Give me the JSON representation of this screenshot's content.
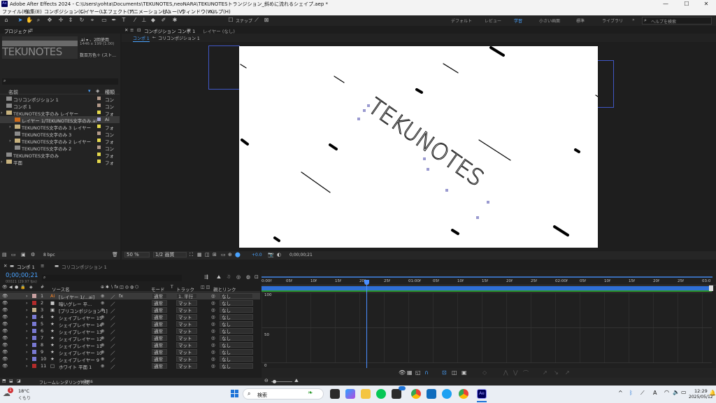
{
  "titlebar": {
    "title": "Adobe After Effects 2024 - C:\\Users\\yohta\\Documents\\TEKUNOTES,neoNARA\\TEKUNOTESトランジション_斜めに流れるシェイプ.aep *",
    "logo": "Ae",
    "min": "—",
    "max": "☐",
    "close": "✕"
  },
  "menu": [
    "ファイル(F)",
    "編集(E)",
    "コンポジション(C)",
    "レイヤー(L)",
    "エフェクト(T)",
    "アニメーション(A)",
    "ビュー(V)",
    "ウィンドウ(W)",
    "ヘルプ(H)"
  ],
  "toolbar": {
    "snap": "スナップ",
    "workspaces": [
      "デフォルト",
      "レビュー",
      "学習",
      "小さい画面",
      "標準",
      "ライブラリ"
    ],
    "search_placeholder": "ヘルプを検索"
  },
  "project": {
    "tab": "プロジェクト",
    "thumb_text": "TEKUNOTES",
    "info1": ".ai ▾ 、2回使用",
    "info2": "1446 x 199 (1.00)",
    "info3": "数百万色＋ (スト...",
    "columns": {
      "name": "名前",
      "type": "種類"
    },
    "items": [
      {
        "name": "コリコンポジション 1",
        "type": "コン",
        "kind": "comp",
        "indent": 0
      },
      {
        "name": "コンポ 1",
        "type": "コン",
        "kind": "comp",
        "indent": 0
      },
      {
        "name": "TEKUNOTES文字のみ レイヤー",
        "type": "フォ",
        "kind": "folder",
        "indent": 0
      },
      {
        "name": "レイヤー 1/TEKUNOTES文字のみ.ai",
        "type": "Ai",
        "kind": "ai",
        "indent": 1
      },
      {
        "name": "TEKUNOTES文字のみ 3 レイヤー",
        "type": "フォ",
        "kind": "folder",
        "indent": 1
      },
      {
        "name": "TEKUNOTES文字のみ 3",
        "type": "コン",
        "kind": "comp",
        "indent": 1
      },
      {
        "name": "TEKUNOTES文字のみ 2 レイヤー",
        "type": "フォ",
        "kind": "folder",
        "indent": 1
      },
      {
        "name": "TEKUNOTES文字のみ 2",
        "type": "コン",
        "kind": "comp",
        "indent": 1
      },
      {
        "name": "TEKUNOTES文字のみ",
        "type": "フォ",
        "kind": "comp",
        "indent": 0
      },
      {
        "name": "平面",
        "type": "フォ",
        "kind": "folder",
        "indent": 0
      }
    ],
    "bpc": "8 bpc"
  },
  "comp": {
    "tab": "コンポジション コンポ 1",
    "layer_tab": "レイヤー (なし)",
    "breadcrumbs": [
      "コンポ 1",
      "コリコンポジション 1"
    ],
    "canvas_text": "TEKUNOTES",
    "zoom": "50 %",
    "resolution": "1/2 画質",
    "exposure": "+0.0",
    "timecode": "0;00;00;21"
  },
  "timeline": {
    "tabs": [
      "コンポ 1",
      "コリコンポジション 1"
    ],
    "current_time": "0;00;00;21",
    "frame_info": "00021 (29.97 fps)",
    "headers": {
      "source": "ソース名",
      "mode": "モード",
      "track": "トラックマット",
      "parent": "親とリンク"
    },
    "ruler": [
      "0:00f",
      "05f",
      "10f",
      "15f",
      "20f",
      "25f",
      "01:00f",
      "05f",
      "10f",
      "15f",
      "20f",
      "25f",
      "02:00f",
      "05f",
      "10f",
      "15f",
      "20f",
      "25f",
      "03:0"
    ],
    "graph_labels": [
      "100",
      "50",
      "0"
    ],
    "layers": [
      {
        "num": "1",
        "name": "[レイヤー 1/...ai]",
        "color": "#c8a0a0",
        "mode": "通常",
        "track": "1. 平行",
        "parent": "なし",
        "icon": "Ai"
      },
      {
        "num": "2",
        "name": "暗いグレー 平...",
        "color": "#b22b2b",
        "mode": "通常",
        "track": "マット",
        "parent": "なし",
        "icon": "■"
      },
      {
        "num": "3",
        "name": "[プリコンポジション 1]",
        "color": "#c2b08a",
        "mode": "通常",
        "track": "マット",
        "parent": "なし",
        "icon": "▣"
      },
      {
        "num": "4",
        "name": "シェイプレイヤー 15",
        "color": "#7979d2",
        "mode": "通常",
        "track": "マット",
        "parent": "なし",
        "icon": "★"
      },
      {
        "num": "5",
        "name": "シェイプレイヤー 14",
        "color": "#7979d2",
        "mode": "通常",
        "track": "マット",
        "parent": "なし",
        "icon": "★"
      },
      {
        "num": "6",
        "name": "シェイプレイヤー 13",
        "color": "#7979d2",
        "mode": "通常",
        "track": "マット",
        "parent": "なし",
        "icon": "★"
      },
      {
        "num": "7",
        "name": "シェイプレイヤー 12",
        "color": "#7979d2",
        "mode": "通常",
        "track": "マット",
        "parent": "なし",
        "icon": "★"
      },
      {
        "num": "8",
        "name": "シェイプレイヤー 11",
        "color": "#7979d2",
        "mode": "通常",
        "track": "マット",
        "parent": "なし",
        "icon": "★"
      },
      {
        "num": "9",
        "name": "シェイプレイヤー 10",
        "color": "#7979d2",
        "mode": "通常",
        "track": "マット",
        "parent": "なし",
        "icon": "★"
      },
      {
        "num": "10",
        "name": "シェイプレイヤー 9",
        "color": "#7979d2",
        "mode": "通常",
        "track": "マット",
        "parent": "なし",
        "icon": "★"
      },
      {
        "num": "11",
        "name": "ホワイト 平面 1",
        "color": "#b22b2b",
        "mode": "通常",
        "track": "マット",
        "parent": "なし",
        "icon": "□"
      }
    ],
    "status": "フレームレンダリング時間",
    "render_time": "1ms"
  },
  "taskbar": {
    "temp": "18°C",
    "weather": "くもり",
    "search": "検索",
    "time": "12:29",
    "date": "2025/05/12",
    "badge": "1",
    "lang": "A"
  }
}
